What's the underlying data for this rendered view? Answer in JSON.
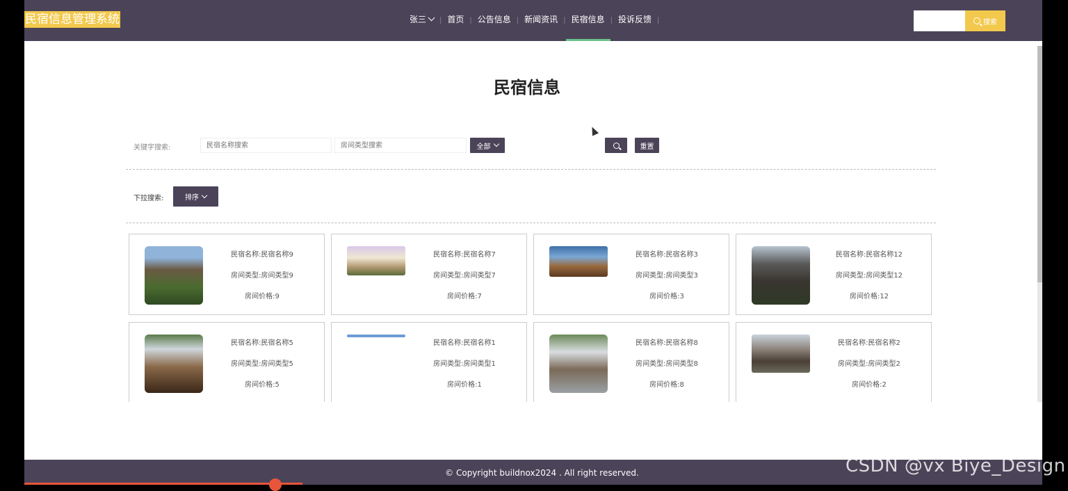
{
  "header": {
    "brand": "民宿信息管理系统",
    "user": "张三",
    "nav": [
      {
        "label": "首页"
      },
      {
        "label": "公告信息"
      },
      {
        "label": "新闻资讯"
      },
      {
        "label": "民宿信息",
        "active": true
      },
      {
        "label": "投诉反馈"
      }
    ],
    "search_value": "",
    "search_button": "搜索"
  },
  "page": {
    "title": "民宿信息",
    "keyword_label": "关键字搜索:",
    "name_placeholder": "民宿名称搜索",
    "type_placeholder": "房间类型搜索",
    "all_button": "全部",
    "reset_button": "重置",
    "dropdown_label": "下拉搜索:",
    "sort_button": "排序"
  },
  "cards": [
    {
      "name": "民宿名称:民宿名称9",
      "type": "房间类型:房间类型9",
      "price": "房间价格:9"
    },
    {
      "name": "民宿名称:民宿名称7",
      "type": "房间类型:房间类型7",
      "price": "房间价格:7"
    },
    {
      "name": "民宿名称:民宿名称3",
      "type": "房间类型:房间类型3",
      "price": "房间价格:3"
    },
    {
      "name": "民宿名称:民宿名称12",
      "type": "房间类型:房间类型12",
      "price": "房间价格:12"
    },
    {
      "name": "民宿名称:民宿名称5",
      "type": "房间类型:房间类型5",
      "price": "房间价格:5"
    },
    {
      "name": "民宿名称:民宿名称1",
      "type": "房间类型:房间类型1",
      "price": "房间价格:1"
    },
    {
      "name": "民宿名称:民宿名称8",
      "type": "房间类型:房间类型8",
      "price": "房间价格:8"
    },
    {
      "name": "民宿名称:民宿名称2",
      "type": "房间类型:房间类型2",
      "price": "房间价格:2"
    }
  ],
  "footer": {
    "copyright": "© Copyright buildnox2024 . All right reserved.",
    "watermark": "CSDN @vx  Biye_Design"
  },
  "colors": {
    "header_bg": "#4b4358",
    "accent": "#f2c94c",
    "active_underline": "#6ac28b"
  }
}
